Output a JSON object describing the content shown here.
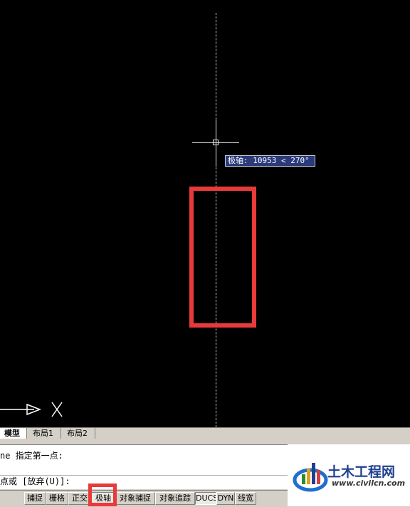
{
  "tooltip": {
    "text": "极轴: 10953 < 270°"
  },
  "tabs": [
    {
      "label": "模型",
      "active": true
    },
    {
      "label": "布局1",
      "active": false
    },
    {
      "label": "布局2",
      "active": false
    }
  ],
  "command": {
    "line1": "ne 指定第一点:",
    "line2": "点或 [放弃(U)]:"
  },
  "status_buttons": [
    {
      "label": "捕捉",
      "on": false
    },
    {
      "label": "栅格",
      "on": false
    },
    {
      "label": "正交",
      "on": false
    },
    {
      "label": "极轴",
      "on": true
    },
    {
      "label": "对象捕捉",
      "on": false
    },
    {
      "label": "对象追踪",
      "on": false
    },
    {
      "label": "DUCS",
      "on": true
    },
    {
      "label": "DYN",
      "on": false
    },
    {
      "label": "线宽",
      "on": false
    }
  ],
  "watermark": {
    "title": "土木工程网",
    "url": "www.civilcn.com"
  },
  "colors": {
    "canvas": "#000000",
    "highlight": "#e83a3a",
    "tooltip_bg": "#2b3a78",
    "logo_blue": "#1f3f8f"
  }
}
